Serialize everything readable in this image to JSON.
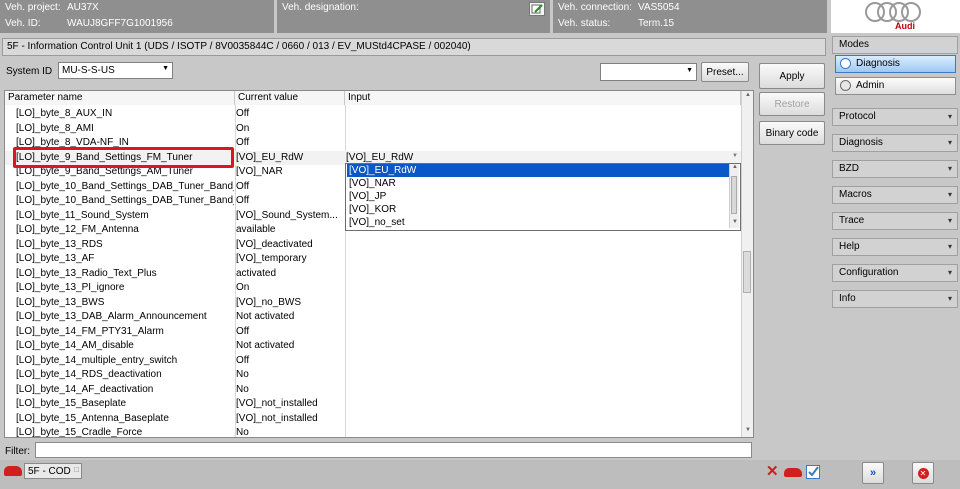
{
  "header": {
    "veh_project_label": "Veh. project:",
    "veh_project_value": "AU37X",
    "veh_id_label": "Veh. ID:",
    "veh_id_value": "WAUJ8GFF7G1001956",
    "veh_designation_label": "Veh. designation:",
    "veh_connection_label": "Veh. connection:",
    "veh_connection_value": "VAS5054",
    "veh_status_label": "Veh. status:",
    "veh_status_value": "Term.15",
    "brand": "Audi"
  },
  "breadcrumb": "5F - Information Control Unit 1  (UDS / ISOTP / 8V0035844C  / 0660 / 013 / EV_MUStd4CPASE / 002040)",
  "system_id": {
    "label": "System ID",
    "value": "MU-S-S-US"
  },
  "buttons": {
    "preset": "Preset...",
    "apply": "Apply",
    "restore": "Restore",
    "binary_code": "Binary code"
  },
  "table": {
    "headers": [
      "Parameter name",
      "Current value",
      "Input"
    ],
    "rows": [
      [
        "[LO]_byte_8_AUX_IN",
        "Off",
        ""
      ],
      [
        "[LO]_byte_8_AMI",
        "On",
        ""
      ],
      [
        "[LO]_byte_8_VDA-NF_IN",
        "Off",
        ""
      ],
      [
        "[LO]_byte_9_Band_Settings_FM_Tuner",
        "[VO]_EU_RdW",
        "[VO]_EU_RdW"
      ],
      [
        "[LO]_byte_9_Band_Settings_AM_Tuner",
        "[VO]_NAR",
        ""
      ],
      [
        "[LO]_byte_10_Band_Settings_DAB_Tuner_Band_...",
        "Off",
        ""
      ],
      [
        "[LO]_byte_10_Band_Settings_DAB_Tuner_Band_...",
        "Off",
        ""
      ],
      [
        "[LO]_byte_11_Sound_System",
        "[VO]_Sound_System...",
        ""
      ],
      [
        "[LO]_byte_12_FM_Antenna",
        "available",
        ""
      ],
      [
        "[LO]_byte_13_RDS",
        "[VO]_deactivated",
        ""
      ],
      [
        "[LO]_byte_13_AF",
        "[VO]_temporary",
        ""
      ],
      [
        "[LO]_byte_13_Radio_Text_Plus",
        "activated",
        ""
      ],
      [
        "[LO]_byte_13_PI_ignore",
        "On",
        ""
      ],
      [
        "[LO]_byte_13_BWS",
        "[VO]_no_BWS",
        ""
      ],
      [
        "[LO]_byte_13_DAB_Alarm_Announcement",
        "Not activated",
        ""
      ],
      [
        "[LO]_byte_14_FM_PTY31_Alarm",
        "Off",
        ""
      ],
      [
        "[LO]_byte_14_AM_disable",
        "Not activated",
        ""
      ],
      [
        "[LO]_byte_14_multiple_entry_switch",
        "Off",
        ""
      ],
      [
        "[LO]_byte_14_RDS_deactivation",
        "No",
        ""
      ],
      [
        "[LO]_byte_14_AF_deactivation",
        "No",
        ""
      ],
      [
        "[LO]_byte_15_Baseplate",
        "[VO]_not_installed",
        ""
      ],
      [
        "[LO]_byte_15_Antenna_Baseplate",
        "[VO]_not_installed",
        ""
      ],
      [
        "[LO]_byte_15_Cradle_Force",
        "No",
        ""
      ]
    ]
  },
  "dropdown_options": [
    "[VO]_EU_RdW",
    "[VO]_NAR",
    "[VO]_JP",
    "[VO]_KOR",
    "[VO]_no_set"
  ],
  "filter_label": "Filter:",
  "sidebar": {
    "modes": "Modes",
    "diagnosis_mode": "Diagnosis",
    "admin_mode": "Admin",
    "menus": [
      "Protocol",
      "Diagnosis",
      "BZD",
      "Macros",
      "Trace",
      "Help",
      "Configuration",
      "Info"
    ]
  },
  "footer": {
    "tab": "5F - COD"
  },
  "colors": {
    "highlight_box": "#e0141e",
    "selected_item": "#0a58c8"
  }
}
